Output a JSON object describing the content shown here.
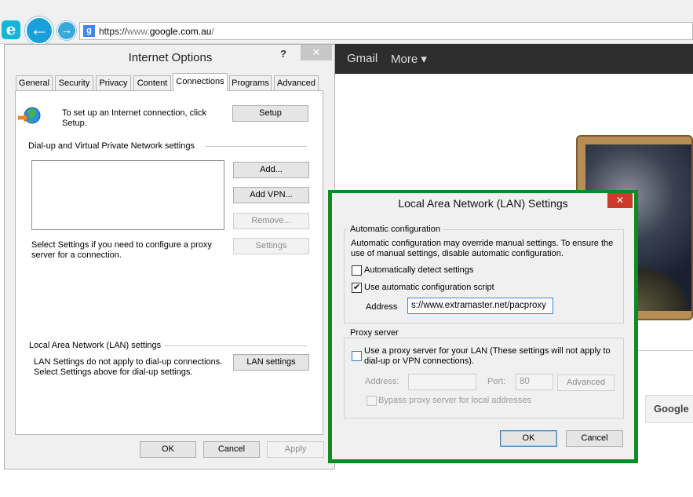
{
  "browser": {
    "url_scheme": "https://",
    "url_sub": "www.",
    "url_host": "google.com.au",
    "url_path": "/",
    "logo_glyph": "e",
    "back_glyph": "←",
    "forward_glyph": "→",
    "favicon_glyph": "g"
  },
  "google": {
    "gmail": "Gmail",
    "more": "More ▾",
    "search_button": "Google"
  },
  "internet_options": {
    "title": "Internet Options",
    "help_glyph": "?",
    "close_glyph": "✕",
    "tabs": [
      {
        "label": "General"
      },
      {
        "label": "Security"
      },
      {
        "label": "Privacy"
      },
      {
        "label": "Content"
      },
      {
        "label": "Connections"
      },
      {
        "label": "Programs"
      },
      {
        "label": "Advanced"
      }
    ],
    "setup_text_1": "To set up an Internet connection, click",
    "setup_text_2": "Setup.",
    "setup_button": "Setup",
    "dialup_header": "Dial-up and Virtual Private Network settings",
    "add_button": "Add...",
    "add_vpn_button": "Add VPN...",
    "remove_button": "Remove...",
    "settings_button": "Settings",
    "proxy_text_1": "Select Settings if you need to configure a proxy",
    "proxy_text_2": "server for a connection.",
    "lan_header": "Local Area Network (LAN) settings",
    "lan_text_1": "LAN Settings do not apply to dial-up connections.",
    "lan_text_2": "Select Settings above for dial-up settings.",
    "lan_settings_button": "LAN settings",
    "ok_button": "OK",
    "cancel_button": "Cancel",
    "apply_button": "Apply"
  },
  "lan_settings": {
    "title": "Local Area Network (LAN) Settings",
    "close_glyph": "✕",
    "auto_config_legend": "Automatic configuration",
    "auto_config_desc_1": "Automatic configuration may override manual settings.  To ensure the",
    "auto_config_desc_2": "use of manual settings, disable automatic configuration.",
    "auto_detect_label": "Automatically detect settings",
    "auto_detect_checked": false,
    "use_script_label": "Use automatic configuration script",
    "use_script_checked": true,
    "address_label": "Address",
    "address_value": "s://www.extramaster.net/pacproxy",
    "proxy_legend": "Proxy server",
    "use_proxy_label_1": "Use a proxy server for your LAN (These settings will not apply to",
    "use_proxy_label_2": "dial-up or VPN connections).",
    "use_proxy_checked": false,
    "proxy_address_label": "Address:",
    "proxy_address_value": "",
    "port_label": "Port:",
    "port_value": "80",
    "advanced_button": "Advanced",
    "bypass_label": "Bypass proxy server for local addresses",
    "bypass_checked": false,
    "ok_button": "OK",
    "cancel_button": "Cancel"
  }
}
